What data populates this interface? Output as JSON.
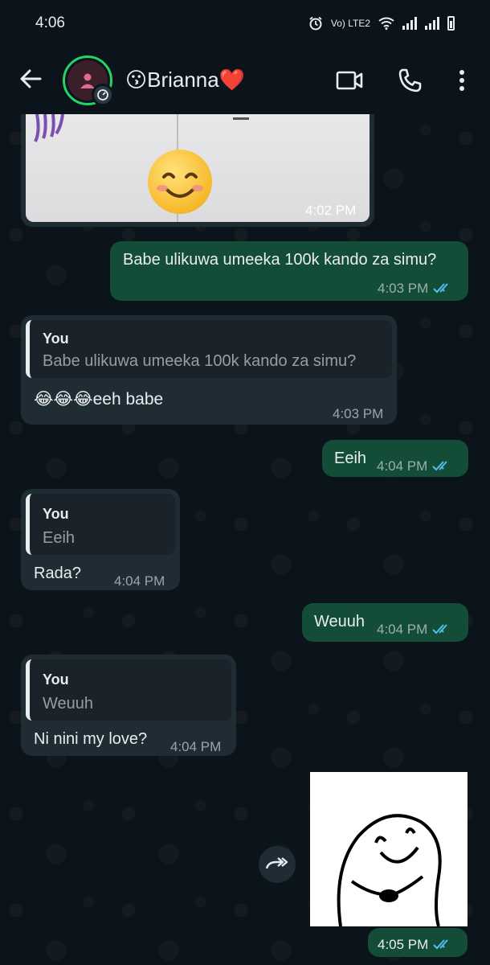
{
  "status_bar": {
    "time": "4:06",
    "network_label": "Vo) LTE2"
  },
  "header": {
    "contact_name": "😗Brianna❤️",
    "icons": [
      "back-arrow-icon",
      "video-call-icon",
      "voice-call-icon",
      "more-options-icon"
    ]
  },
  "messages": [
    {
      "type": "image",
      "direction": "in",
      "time": "4:02 PM"
    },
    {
      "type": "text",
      "direction": "out",
      "text": "Babe ulikuwa umeeka 100k kando za simu?",
      "time": "4:03 PM",
      "read": true
    },
    {
      "type": "reply",
      "direction": "in",
      "quote_author": "You",
      "quote_text": "Babe ulikuwa umeeka 100k kando za simu?",
      "text": "😂😂😂eeh babe",
      "time": "4:03 PM"
    },
    {
      "type": "text",
      "direction": "out",
      "text": "Eeih",
      "time": "4:04 PM",
      "read": true
    },
    {
      "type": "reply",
      "direction": "in",
      "quote_author": "You",
      "quote_text": "Eeih",
      "text": "Rada?",
      "time": "4:04 PM"
    },
    {
      "type": "text",
      "direction": "out",
      "text": "Weuuh",
      "time": "4:04 PM",
      "read": true
    },
    {
      "type": "reply",
      "direction": "in",
      "quote_author": "You",
      "quote_text": "Weuuh",
      "text": "Ni nini my love?",
      "time": "4:04 PM"
    },
    {
      "type": "sticker",
      "direction": "out",
      "time": "4:05 PM",
      "read": true
    }
  ],
  "colors": {
    "background": "#0b141a",
    "outgoing_bubble": "#144d37",
    "incoming_bubble": "#1f2c34",
    "read_ticks": "#53bdeb",
    "status_ring": "#25d366",
    "header_heart": "#e0245e"
  }
}
